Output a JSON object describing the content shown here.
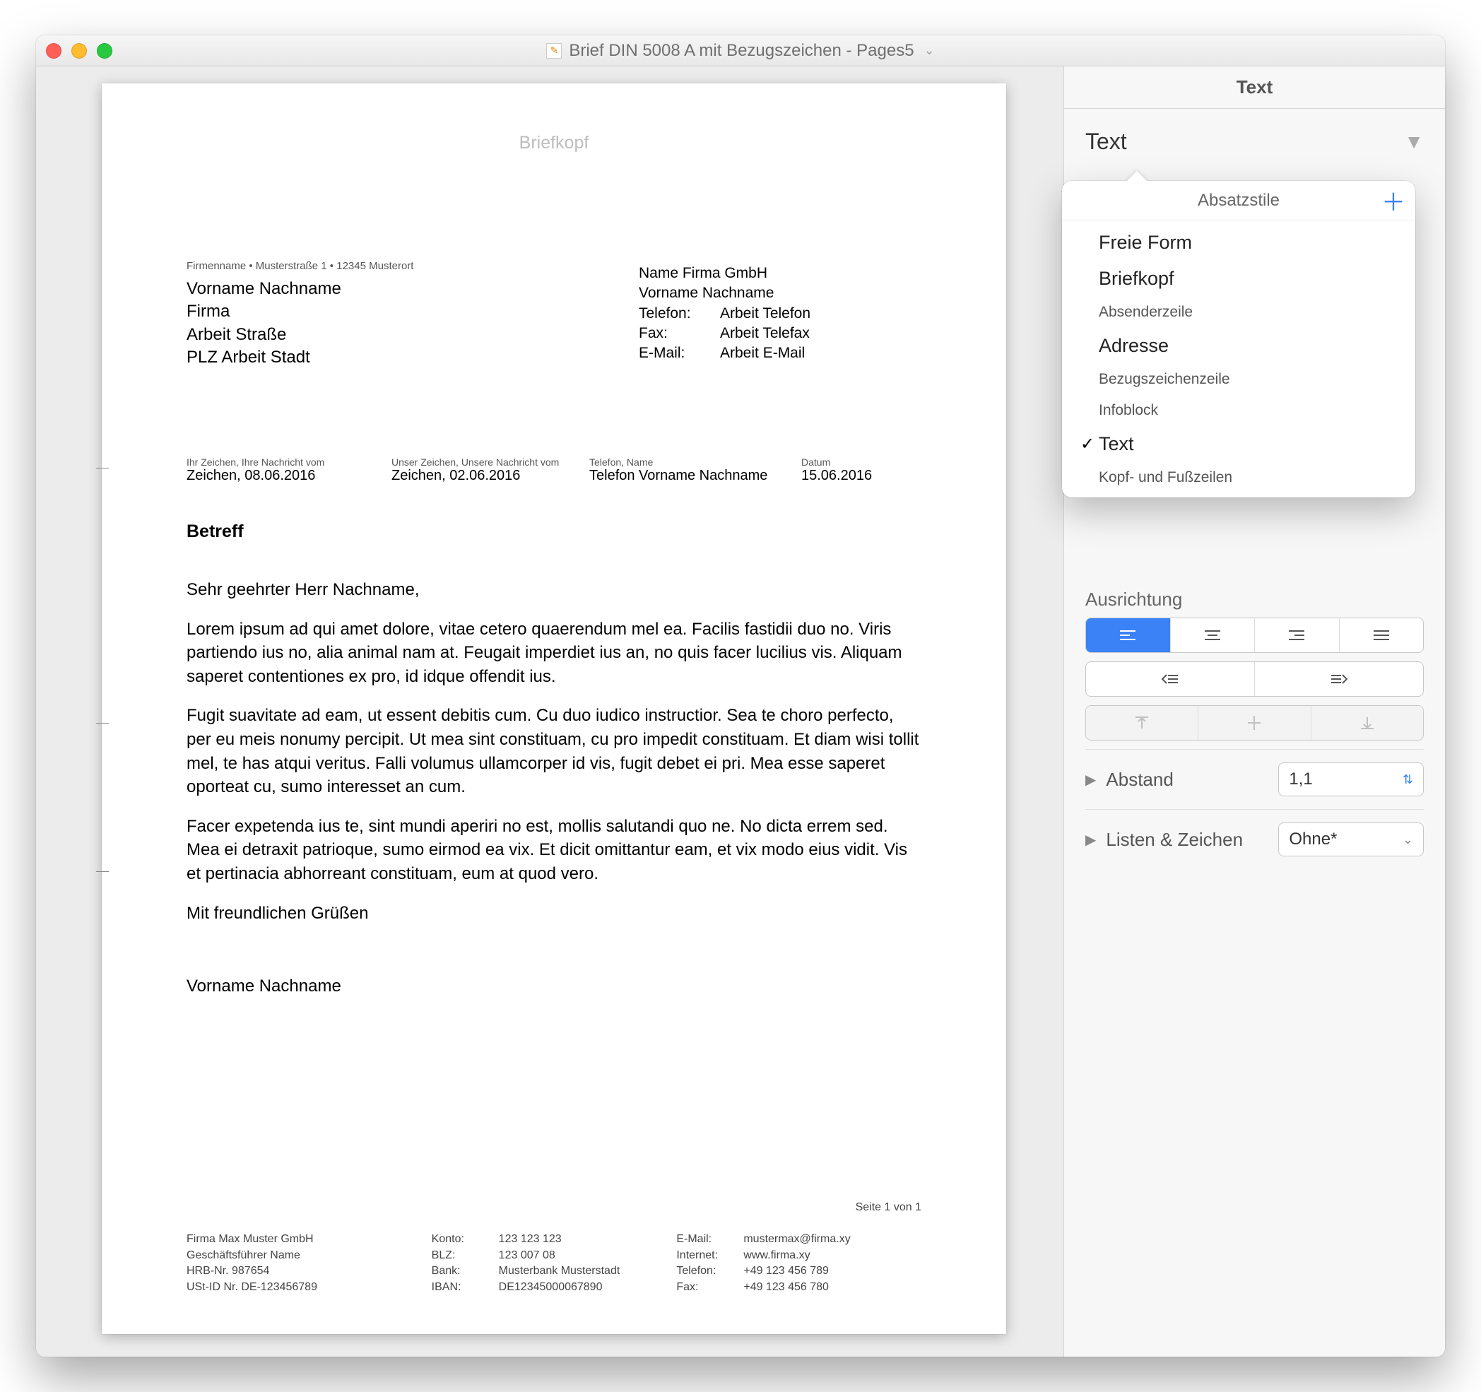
{
  "window": {
    "title": "Brief DIN 5008 A mit Bezugszeichen - Pages5"
  },
  "document": {
    "briefkopf": "Briefkopf",
    "sender_line": "Firmenname • Musterstraße 1 • 12345 Musterort",
    "address": {
      "l1": "Vorname Nachname",
      "l2": "Firma",
      "l3": "Arbeit Straße",
      "l4": "PLZ Arbeit Stadt"
    },
    "infoblock": {
      "company": "Name Firma GmbH",
      "person": "Vorname Nachname",
      "tel_label": "Telefon:",
      "tel_val": "Arbeit Telefon",
      "fax_label": "Fax:",
      "fax_val": "Arbeit Telefax",
      "email_label": "E-Mail:",
      "email_val": "Arbeit E-Mail"
    },
    "ref": {
      "c1h": "Ihr Zeichen, Ihre Nachricht vom",
      "c1v": "Zeichen, 08.06.2016",
      "c2h": "Unser Zeichen, Unsere Nachricht vom",
      "c2v": "Zeichen, 02.06.2016",
      "c3h": "Telefon, Name",
      "c3v": "Telefon Vorname Nachname",
      "c4h": "Datum",
      "c4v": "15.06.2016"
    },
    "subject": "Betreff",
    "salutation": "Sehr geehrter Herr Nachname,",
    "p1": "Lorem ipsum ad qui amet dolore, vitae cetero quaerendum mel ea. Facilis fastidii duo no. Viris partiendo ius no, alia animal nam at. Feugait imperdiet ius an, no quis facer lucilius vis. Aliquam saperet contentiones ex pro, id idque offendit ius.",
    "p2": "Fugit suavitate ad eam, ut essent debitis cum. Cu duo iudico instructior. Sea te choro perfecto, per eu meis nonumy percipit. Ut mea sint constituam, cu pro impedit constituam. Et diam wisi tollit mel, te has atqui veritus. Falli volumus ullamcorper id vis, fugit debet ei pri. Mea esse saperet oporteat cu, sumo interesset an cum.",
    "p3": "Facer expetenda ius te, sint mundi aperiri no est, mollis salutandi quo ne. No dicta errem sed. Mea ei detraxit patrioque, sumo eirmod ea vix. Et dicit omittantur eam, et vix modo eius vidit. Vis et pertinacia abhorreant constituam, eum at quod vero.",
    "closing": "Mit freundlichen Grüßen",
    "signature": "Vorname Nachname",
    "page_footer": "Seite 1 von 1",
    "footer": {
      "c1": {
        "l1": "Firma Max Muster GmbH",
        "l2": "Geschäftsführer Name",
        "l3": "HRB-Nr. 987654",
        "l4": "USt-ID Nr. DE-123456789"
      },
      "c2": {
        "konto_l": "Konto:",
        "konto_v": "123 123 123",
        "blz_l": "BLZ:",
        "blz_v": "123 007 08",
        "bank_l": "Bank:",
        "bank_v": "Musterbank Musterstadt",
        "iban_l": "IBAN:",
        "iban_v": "DE12345000067890"
      },
      "c3": {
        "mail_l": "E-Mail:",
        "mail_v": "mustermax@firma.xy",
        "net_l": "Internet:",
        "net_v": "www.firma.xy",
        "tel_l": "Telefon:",
        "tel_v": "+49 123 456 789",
        "fax_l": "Fax:",
        "fax_v": "+49 123 456 780"
      }
    }
  },
  "inspector": {
    "tab": "Text",
    "style_label": "Text",
    "alignment_label": "Ausrichtung",
    "spacing_label": "Abstand",
    "spacing_value": "1,1",
    "lists_label": "Listen & Zeichen",
    "lists_value": "Ohne*"
  },
  "popover": {
    "title": "Absatzstile",
    "items": [
      {
        "label": "Freie Form",
        "size": "large",
        "checked": false
      },
      {
        "label": "Briefkopf",
        "size": "large",
        "checked": false
      },
      {
        "label": "Absenderzeile",
        "size": "small",
        "checked": false
      },
      {
        "label": "Adresse",
        "size": "large",
        "checked": false
      },
      {
        "label": "Bezugszeichenzeile",
        "size": "small",
        "checked": false
      },
      {
        "label": "Infoblock",
        "size": "small",
        "checked": false
      },
      {
        "label": "Text",
        "size": "large",
        "checked": true
      },
      {
        "label": "Kopf- und Fußzeilen",
        "size": "small",
        "checked": false
      }
    ]
  }
}
